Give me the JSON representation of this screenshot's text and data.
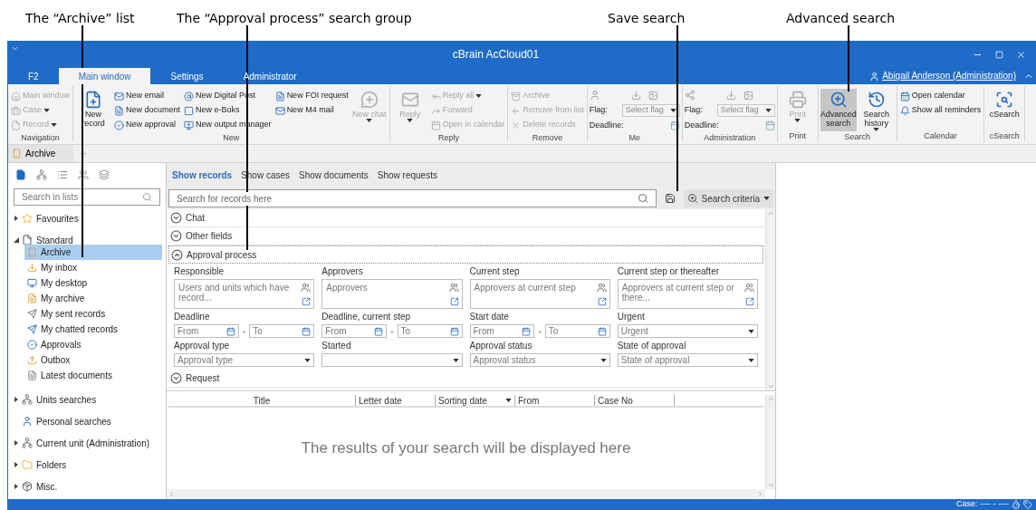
{
  "annotations": [
    {
      "label": "The “Archive” list"
    },
    {
      "label": "The “Approval process” search group"
    },
    {
      "label": "Save search"
    },
    {
      "label": "Advanced search"
    }
  ],
  "window": {
    "title": "cBrain AcCloud01"
  },
  "ribbon_tabs": [
    {
      "label": "F2",
      "selected": false
    },
    {
      "label": "Main window",
      "selected": true
    },
    {
      "label": "Settings",
      "selected": false
    },
    {
      "label": "Administrator",
      "selected": false
    }
  ],
  "user": {
    "name": "Abigail Anderson (Administration)"
  },
  "ribbon_groups": [
    {
      "label": "Navigation",
      "items": [
        {
          "kind": "small",
          "label": "Main window",
          "disabled": true
        },
        {
          "kind": "small",
          "label": "Case",
          "disabled": true,
          "dropdown": true
        },
        {
          "kind": "small",
          "label": "Record",
          "disabled": true,
          "dropdown": true
        }
      ]
    },
    {
      "label": "New",
      "items": [
        {
          "kind": "large",
          "label": "New record",
          "disabled": false
        },
        {
          "kind": "small",
          "label": "New email",
          "disabled": false
        },
        {
          "kind": "small",
          "label": "New document",
          "disabled": false
        },
        {
          "kind": "small",
          "label": "New approval",
          "disabled": false
        },
        {
          "kind": "small",
          "label": "New Digital Post",
          "disabled": false
        },
        {
          "kind": "small",
          "label": "New e-Boks",
          "disabled": false
        },
        {
          "kind": "small",
          "label": "New output manager",
          "disabled": false
        },
        {
          "kind": "small",
          "label": "New FOI request",
          "disabled": false
        },
        {
          "kind": "small",
          "label": "New M4 mail",
          "disabled": false
        },
        {
          "kind": "large",
          "label": "New chat",
          "disabled": true,
          "dropdown": true
        }
      ]
    },
    {
      "label": "Reply",
      "items": [
        {
          "kind": "large",
          "label": "Reply",
          "disabled": true,
          "dropdown": true
        },
        {
          "kind": "small",
          "label": "Reply all",
          "disabled": true,
          "dropdown": true
        },
        {
          "kind": "small",
          "label": "Forward",
          "disabled": true
        },
        {
          "kind": "small",
          "label": "Open in calendar",
          "disabled": true
        }
      ]
    },
    {
      "label": "Remove",
      "items": [
        {
          "kind": "small",
          "label": "Archive",
          "disabled": true
        },
        {
          "kind": "small",
          "label": "Remove from list",
          "disabled": true
        },
        {
          "kind": "small",
          "label": "Delete records",
          "disabled": true
        }
      ]
    },
    {
      "label": "Me",
      "items": [
        {
          "kind": "flag",
          "flag_label": "Flag:",
          "flag_value": "Select flag",
          "deadline_label": "Deadline:"
        }
      ]
    },
    {
      "label": "Administration",
      "items": [
        {
          "kind": "flag",
          "flag_label": "Flag:",
          "flag_value": "Select flag",
          "deadline_label": "Deadline:"
        }
      ]
    },
    {
      "label": "Print",
      "items": [
        {
          "kind": "large",
          "label": "Print",
          "disabled": true,
          "dropdown": true
        }
      ]
    },
    {
      "label": "Search",
      "items": [
        {
          "kind": "large",
          "label": "Advanced search",
          "disabled": false,
          "active": true
        },
        {
          "kind": "large",
          "label": "Search history",
          "disabled": false,
          "active": false,
          "dropdown": true
        }
      ]
    },
    {
      "label": "Calendar",
      "items": [
        {
          "kind": "small",
          "label": "Open calendar",
          "disabled": false
        },
        {
          "kind": "small",
          "label": "Show all reminders",
          "disabled": false
        }
      ]
    },
    {
      "label": "cSearch",
      "items": [
        {
          "kind": "large",
          "label": "cSearch",
          "disabled": false
        }
      ]
    }
  ],
  "doc_tabs": [
    {
      "label": "Archive",
      "selected": true
    }
  ],
  "sidebar": {
    "search_placeholder": "Search in lists",
    "tree": [
      {
        "label": "Favourites",
        "expanded": false
      },
      {
        "label": "Standard",
        "expanded": true,
        "children": [
          {
            "label": "Archive",
            "selected": true
          },
          {
            "label": "My inbox",
            "selected": false
          },
          {
            "label": "My desktop",
            "selected": false
          },
          {
            "label": "My archive",
            "selected": false
          },
          {
            "label": "My sent records",
            "selected": false
          },
          {
            "label": "My chatted records",
            "selected": false
          },
          {
            "label": "Approvals",
            "selected": false
          },
          {
            "label": "Outbox",
            "selected": false
          },
          {
            "label": "Latest documents",
            "selected": false
          }
        ]
      },
      {
        "label": "Units searches",
        "expanded": false
      },
      {
        "label": "Personal searches"
      },
      {
        "label": "Current unit (Administration)",
        "expanded": false
      },
      {
        "label": "Folders",
        "expanded": false
      },
      {
        "label": "Misc.",
        "expanded": false
      }
    ]
  },
  "main": {
    "view_tabs": [
      {
        "label": "Show records",
        "selected": true
      },
      {
        "label": "Show cases",
        "selected": false
      },
      {
        "label": "Show documents",
        "selected": false
      },
      {
        "label": "Show requests",
        "selected": false
      }
    ],
    "search_placeholder": "Search for records here",
    "criteria_button": "Search criteria",
    "sections": [
      {
        "title": "Chat",
        "expanded": false
      },
      {
        "title": "Other fields",
        "expanded": false
      },
      {
        "title": "Approval process",
        "expanded": true,
        "fields": [
          {
            "kind": "people",
            "label": "Responsible",
            "placeholder": "Users and units which have record..."
          },
          {
            "kind": "people",
            "label": "Approvers",
            "placeholder": "Approvers"
          },
          {
            "kind": "people",
            "label": "Current step",
            "placeholder": "Approvers at current step"
          },
          {
            "kind": "people",
            "label": "Current step or thereafter",
            "placeholder": "Approvers at current step or there..."
          },
          {
            "kind": "date_range",
            "label": "Deadline",
            "from": "From",
            "separator": "-",
            "to": "To"
          },
          {
            "kind": "date_range",
            "label": "Deadline, current step",
            "from": "From",
            "separator": "-",
            "to": "To"
          },
          {
            "kind": "date_range",
            "label": "Start date",
            "from": "From",
            "separator": "-",
            "to": "To"
          },
          {
            "kind": "select",
            "label": "Urgent",
            "placeholder": "Urgent"
          },
          {
            "kind": "select",
            "label": "Approval type",
            "placeholder": "Approval type"
          },
          {
            "kind": "select",
            "label": "Started"
          },
          {
            "kind": "select",
            "label": "Approval status",
            "placeholder": "Approval status"
          },
          {
            "kind": "select",
            "label": "State of approval",
            "placeholder": "State of approval"
          }
        ]
      },
      {
        "title": "Request",
        "expanded": false
      }
    ],
    "results": {
      "columns": [
        {
          "label": "Title",
          "sorted": false
        },
        {
          "label": "Letter date",
          "sorted": false
        },
        {
          "label": "Sorting date",
          "sorted": true
        },
        {
          "label": "From",
          "sorted": false
        },
        {
          "label": "Case No",
          "sorted": false
        }
      ],
      "empty_message": "The results of your search will be displayed here"
    }
  },
  "status_bar": {
    "case": "Case: ---- - ----"
  }
}
